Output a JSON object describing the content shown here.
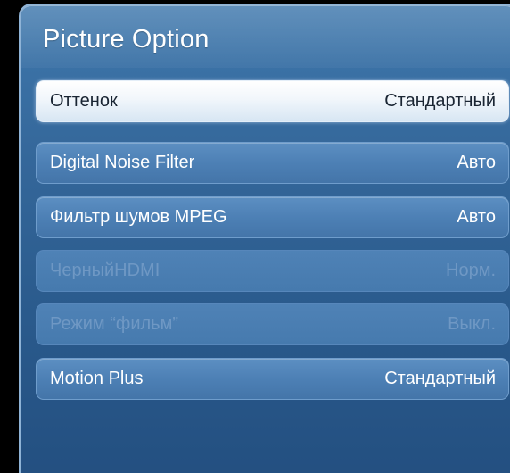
{
  "panel": {
    "title": "Picture Option"
  },
  "menu": {
    "items": [
      {
        "label": "Оттенок",
        "value": "Стандартный",
        "state": "selected"
      },
      {
        "label": "Digital Noise Filter",
        "value": "Авто",
        "state": "normal"
      },
      {
        "label": "Фильтр шумов MPEG",
        "value": "Авто",
        "state": "normal"
      },
      {
        "label": "ЧерныйHDMI",
        "value": "Норм.",
        "state": "disabled"
      },
      {
        "label": "Режим “фильм”",
        "value": "Выкл.",
        "state": "disabled"
      },
      {
        "label": "Motion Plus",
        "value": "Стандартный",
        "state": "normal"
      }
    ]
  },
  "colors": {
    "panel_blue": "#35689b",
    "item_blue": "#4d80b5",
    "selected_white": "#f1f6fb",
    "disabled_text": "#6f98c4"
  }
}
